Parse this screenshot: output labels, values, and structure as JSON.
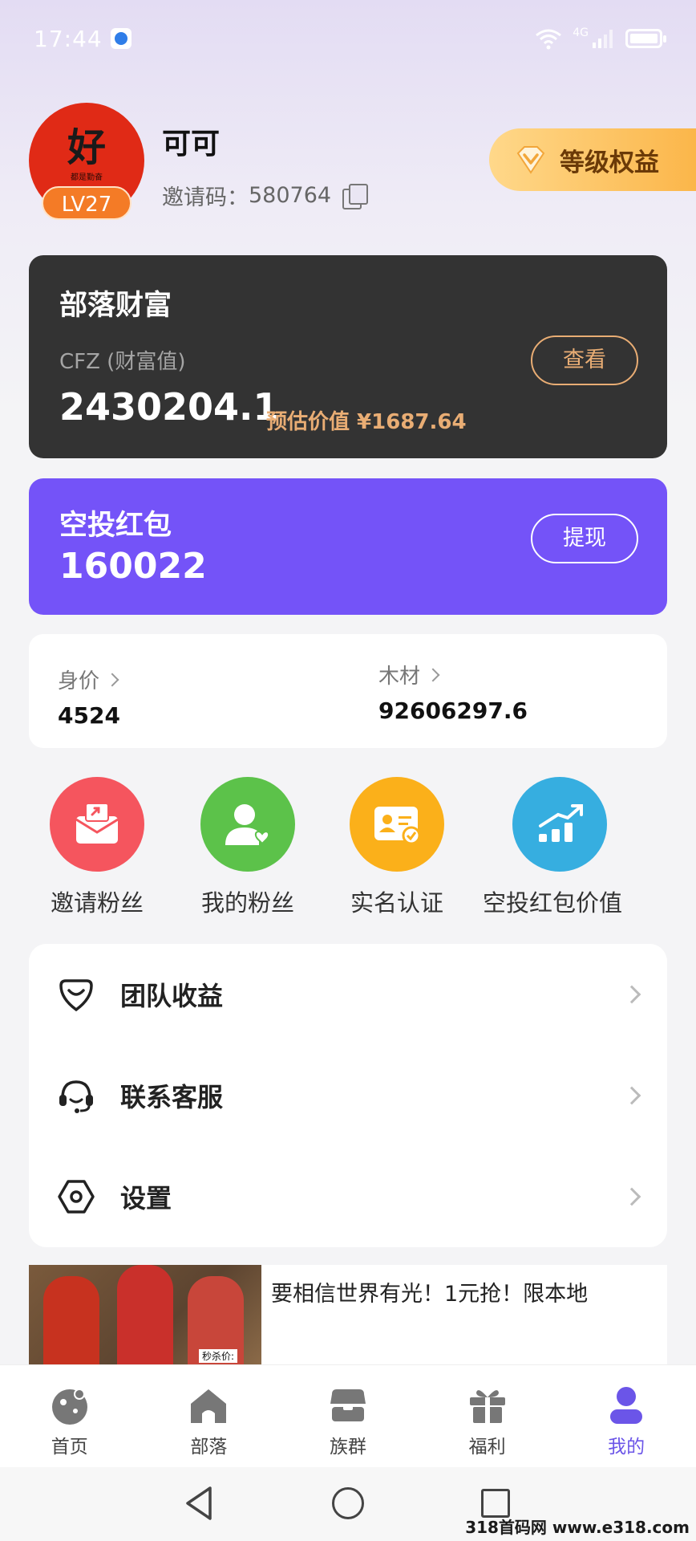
{
  "status_bar": {
    "time": "17:44",
    "network": "4G"
  },
  "profile": {
    "nickname": "可可",
    "avatar_text": "好",
    "avatar_subtext": "都是勤奋",
    "level": "LV27",
    "invite_label": "邀请码：",
    "invite_code": "580764",
    "level_rights_label": "等级权益"
  },
  "wealth_card": {
    "title": "部落财富",
    "label": "CFZ (财富值)",
    "value": "2430204.1",
    "estimate": "预估价值 ¥1687.64",
    "view_button": "查看"
  },
  "airdrop_card": {
    "title": "空投红包",
    "value": "160022",
    "withdraw_button": "提现"
  },
  "stats": [
    {
      "label": "身价",
      "value": "4524"
    },
    {
      "label": "木材",
      "value": "92606297.6"
    }
  ],
  "shortcuts": [
    {
      "label": "邀请粉丝",
      "icon": "invite-envelope-icon",
      "color": "#f5555e"
    },
    {
      "label": "我的粉丝",
      "icon": "user-heart-icon",
      "color": "#5cc24a"
    },
    {
      "label": "实名认证",
      "icon": "id-card-check-icon",
      "color": "#fbb01a"
    },
    {
      "label": "空投红包价值",
      "icon": "rising-chart-icon",
      "color": "#36aee0"
    }
  ],
  "menu": [
    {
      "label": "团队收益",
      "icon": "heart-shield-icon"
    },
    {
      "label": "联系客服",
      "icon": "headset-icon"
    },
    {
      "label": "设置",
      "icon": "settings-hexagon-icon"
    }
  ],
  "ad": {
    "text": "要相信世界有光！1元抢！限本地",
    "tag": "秒杀价:"
  },
  "tabs": [
    {
      "label": "首页",
      "icon": "home-planet-icon",
      "active": false
    },
    {
      "label": "部落",
      "icon": "tribe-house-icon",
      "active": false
    },
    {
      "label": "族群",
      "icon": "group-box-icon",
      "active": false
    },
    {
      "label": "福利",
      "icon": "gift-icon",
      "active": false
    },
    {
      "label": "我的",
      "icon": "profile-icon",
      "active": true
    }
  ],
  "watermark": "318首码网 www.e318.com",
  "colors": {
    "accent": "#7453f8",
    "dark_card": "#333333",
    "gold": "#e9ad74"
  }
}
